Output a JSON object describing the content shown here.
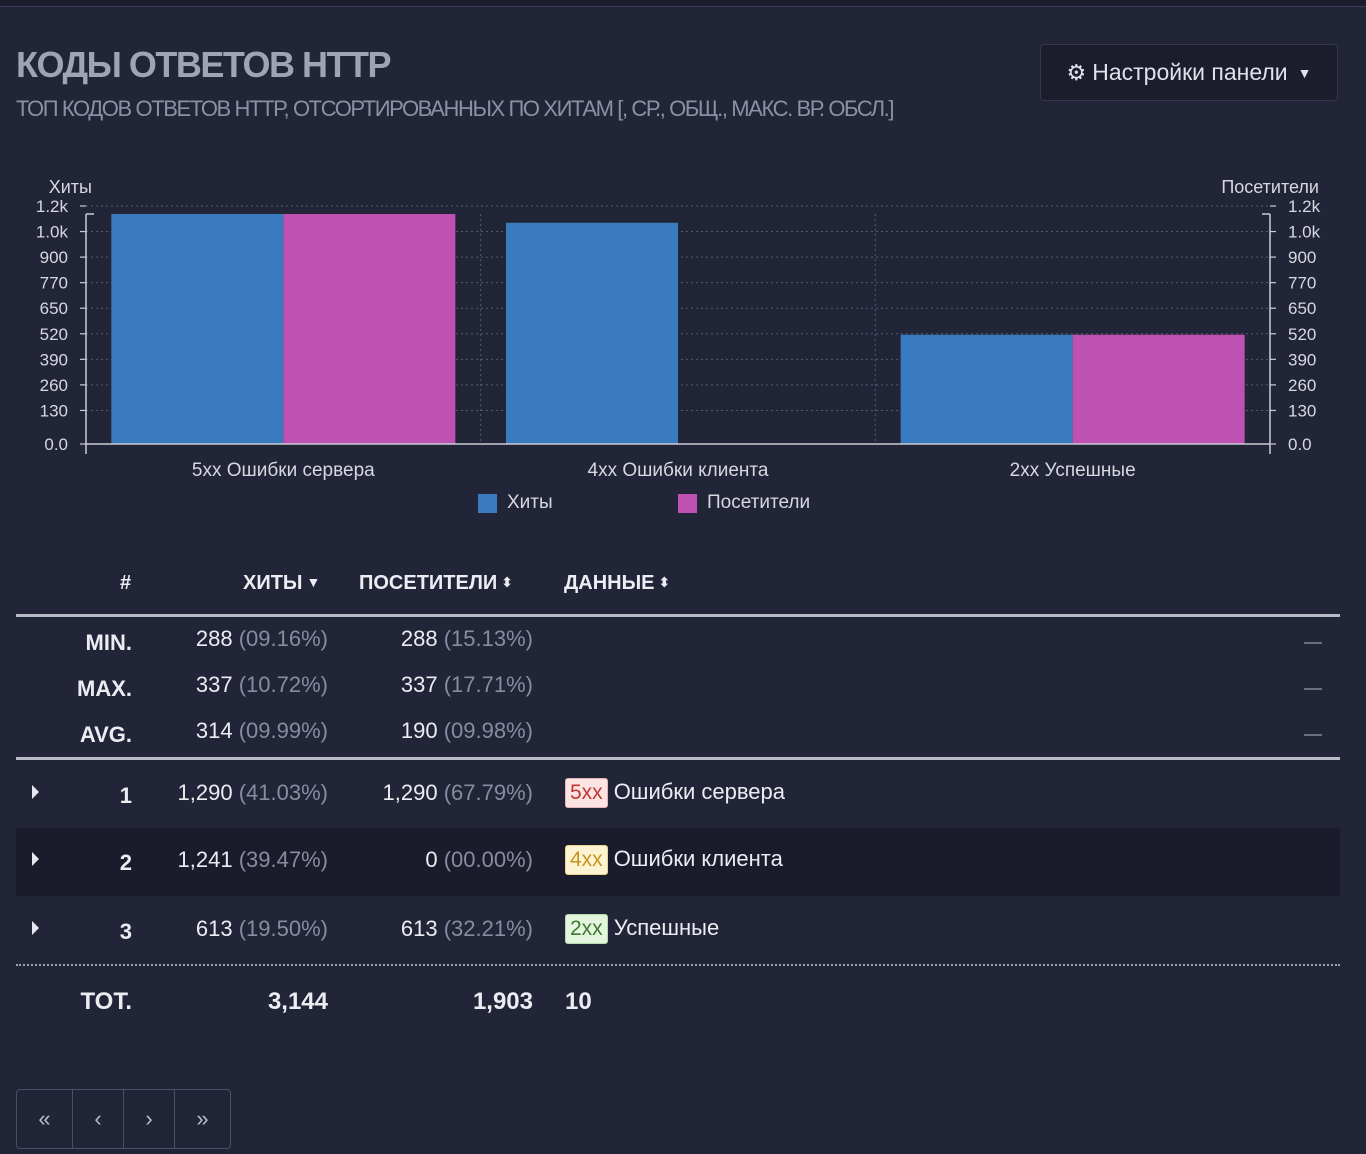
{
  "panel": {
    "title": "КОДЫ ОТВЕТОВ HTTP",
    "subtitle": "ТОП КОДОВ ОТВЕТОВ HTTP, ОТСОРТИРОВАННЫХ ПО ХИТАМ [, СР., ОБЩ., МАКС. ВР. ОБСЛ.]",
    "settings_label": "Настройки панели"
  },
  "chart_data": {
    "type": "bar",
    "categories": [
      "5xx Ошибки сервера",
      "4xx Ошибки клиента",
      "2xx Успешные"
    ],
    "series": [
      {
        "name": "Хиты",
        "values": [
          1290,
          1241,
          613
        ],
        "color": "#3a7bbf",
        "axis": "left"
      },
      {
        "name": "Посетители",
        "values": [
          1290,
          0,
          613
        ],
        "color": "#bf51b3",
        "axis": "right"
      }
    ],
    "left_axis_title": "Хиты",
    "right_axis_title": "Посетители",
    "ytick_labels": [
      "0.0",
      "130",
      "260",
      "390",
      "520",
      "650",
      "770",
      "900",
      "1.0k",
      "1.2k"
    ],
    "ylim": [
      0,
      1290
    ],
    "grid": true,
    "legend_position": "bottom-center"
  },
  "table": {
    "headers": {
      "num": "#",
      "hits": "ХИТЫ",
      "visitors": "ПОСЕТИТЕЛИ",
      "data": "ДАННЫЕ"
    },
    "summary": [
      {
        "label": "MIN.",
        "hits": "288",
        "hits_pct": "(09.16%)",
        "visitors": "288",
        "visitors_pct": "(15.13%)"
      },
      {
        "label": "MAX.",
        "hits": "337",
        "hits_pct": "(10.72%)",
        "visitors": "337",
        "visitors_pct": "(17.71%)"
      },
      {
        "label": "AVG.",
        "hits": "314",
        "hits_pct": "(09.99%)",
        "visitors": "190",
        "visitors_pct": "(09.98%)"
      }
    ],
    "rows": [
      {
        "num": "1",
        "hits": "1,290",
        "hits_pct": "(41.03%)",
        "visitors": "1,290",
        "visitors_pct": "(67.79%)",
        "badge": "5xx",
        "text": "Ошибки сервера"
      },
      {
        "num": "2",
        "hits": "1,241",
        "hits_pct": "(39.47%)",
        "visitors": "0",
        "visitors_pct": "(00.00%)",
        "badge": "4xx",
        "text": "Ошибки клиента"
      },
      {
        "num": "3",
        "hits": "613",
        "hits_pct": "(19.50%)",
        "visitors": "613",
        "visitors_pct": "(32.21%)",
        "badge": "2xx",
        "text": "Успешные"
      }
    ],
    "total": {
      "label": "TOT.",
      "hits": "3,144",
      "visitors": "1,903",
      "data": "10"
    }
  },
  "pager": {
    "first": "«",
    "prev": "‹",
    "next": "›",
    "last": "»"
  }
}
